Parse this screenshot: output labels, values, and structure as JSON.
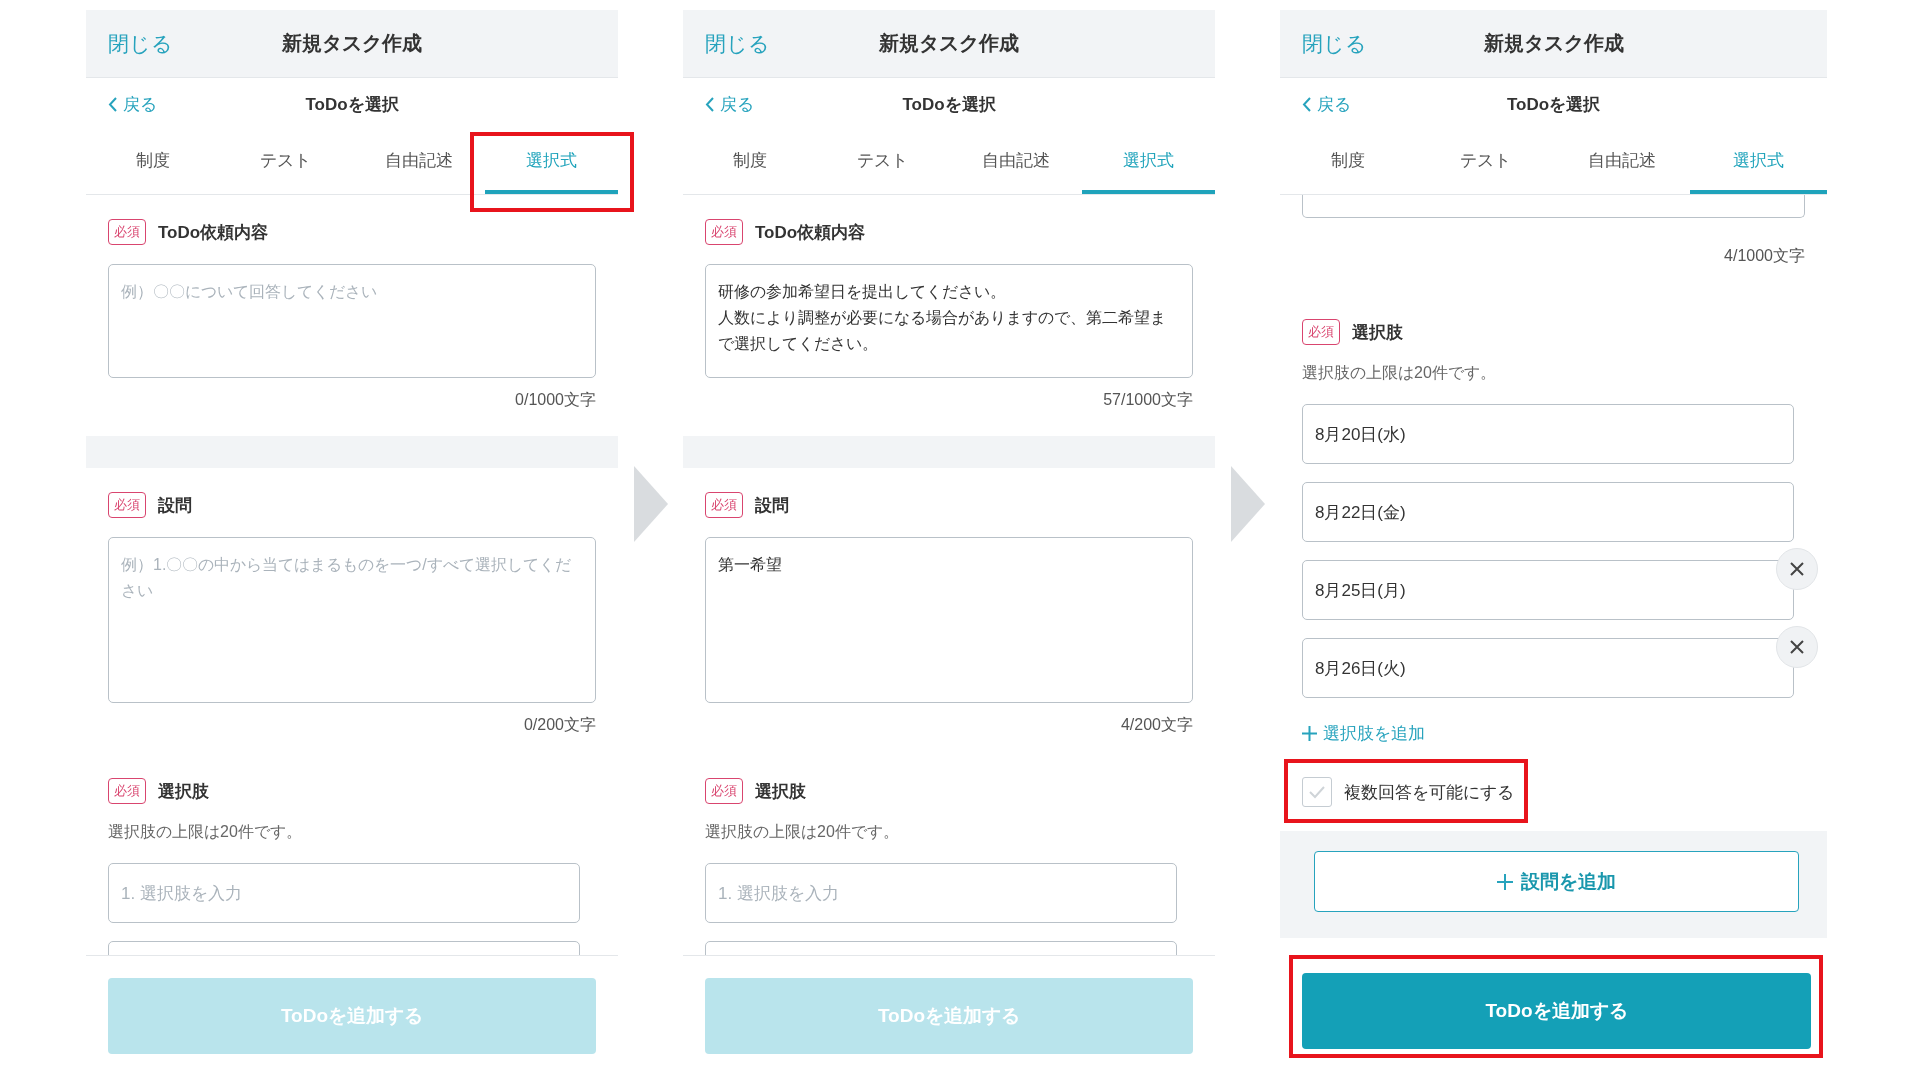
{
  "panels": [
    {
      "header": {
        "close": "閉じる",
        "title": "新規タスク作成"
      },
      "nav": {
        "back": "戻る",
        "title": "ToDoを選択"
      },
      "tabs": [
        {
          "label": "制度",
          "selected": false,
          "highlighted": false
        },
        {
          "label": "テスト",
          "selected": false,
          "highlighted": false
        },
        {
          "label": "自由記述",
          "selected": false,
          "highlighted": false
        },
        {
          "label": "選択式",
          "selected": true,
          "highlighted": true
        }
      ],
      "sections": [
        {
          "kind": "request",
          "badge": "必須",
          "label": "ToDo依頼内容",
          "placeholder": "例）〇〇について回答してください",
          "counter": "0/1000文字"
        },
        {
          "kind": "band"
        },
        {
          "kind": "question",
          "badge": "必須",
          "label": "設問",
          "placeholder": "例）1.〇〇の中から当てはまるものを一つ/すべて選択してください",
          "counter": "0/200文字"
        },
        {
          "kind": "choices",
          "badge": "必須",
          "label": "選択肢",
          "hint": "選択肢の上限は20件です。",
          "options": [
            {
              "placeholder": "1. 選択肢を入力",
              "removable": false
            },
            {
              "removable": false
            }
          ]
        }
      ],
      "submit": {
        "label": "ToDoを追加する",
        "enabled": false,
        "highlighted": false
      }
    },
    {
      "header": {
        "close": "閉じる",
        "title": "新規タスク作成"
      },
      "nav": {
        "back": "戻る",
        "title": "ToDoを選択"
      },
      "tabs": [
        {
          "label": "制度",
          "selected": false,
          "highlighted": false
        },
        {
          "label": "テスト",
          "selected": false,
          "highlighted": false
        },
        {
          "label": "自由記述",
          "selected": false,
          "highlighted": false
        },
        {
          "label": "選択式",
          "selected": true,
          "highlighted": false
        }
      ],
      "sections": [
        {
          "kind": "request",
          "badge": "必須",
          "label": "ToDo依頼内容",
          "lines": [
            "研修の参加希望日を提出してください。",
            "人数により調整が必要になる場合がありますので、第二希望まで選択してください。"
          ],
          "counter": "57/1000文字"
        },
        {
          "kind": "band"
        },
        {
          "kind": "question",
          "badge": "必須",
          "label": "設問",
          "lines": [
            "第一希望"
          ],
          "counter": "4/200文字"
        },
        {
          "kind": "choices",
          "badge": "必須",
          "label": "選択肢",
          "hint": "選択肢の上限は20件です。",
          "options": [
            {
              "placeholder": "1. 選択肢を入力",
              "removable": false
            },
            {
              "removable": false
            }
          ]
        }
      ],
      "submit": {
        "label": "ToDoを追加する",
        "enabled": false,
        "highlighted": false
      }
    },
    {
      "header": {
        "close": "閉じる",
        "title": "新規タスク作成"
      },
      "nav": {
        "back": "戻る",
        "title": "ToDoを選択"
      },
      "tabs": [
        {
          "label": "制度",
          "selected": false,
          "highlighted": false
        },
        {
          "label": "テスト",
          "selected": false,
          "highlighted": false
        },
        {
          "label": "自由記述",
          "selected": false,
          "highlighted": false
        },
        {
          "label": "選択式",
          "selected": true,
          "highlighted": false
        }
      ],
      "sections": [
        {
          "kind": "request-tail",
          "counter": "4/1000文字"
        },
        {
          "kind": "choices",
          "badge": "必須",
          "label": "選択肢",
          "hint": "選択肢の上限は20件です。",
          "options": [
            {
              "value": "8月20日(水)",
              "removable": false
            },
            {
              "value": "8月22日(金)",
              "removable": false
            },
            {
              "value": "8月25日(月)",
              "removable": true
            },
            {
              "value": "8月26日(火)",
              "removable": true
            }
          ],
          "add_label": "選択肢を追加",
          "multiple": {
            "label": "複数回答を可能にする",
            "checked": false,
            "highlighted": true
          }
        },
        {
          "kind": "add-question",
          "label": "設問を追加"
        }
      ],
      "submit": {
        "label": "ToDoを追加する",
        "enabled": true,
        "highlighted": true
      }
    }
  ]
}
